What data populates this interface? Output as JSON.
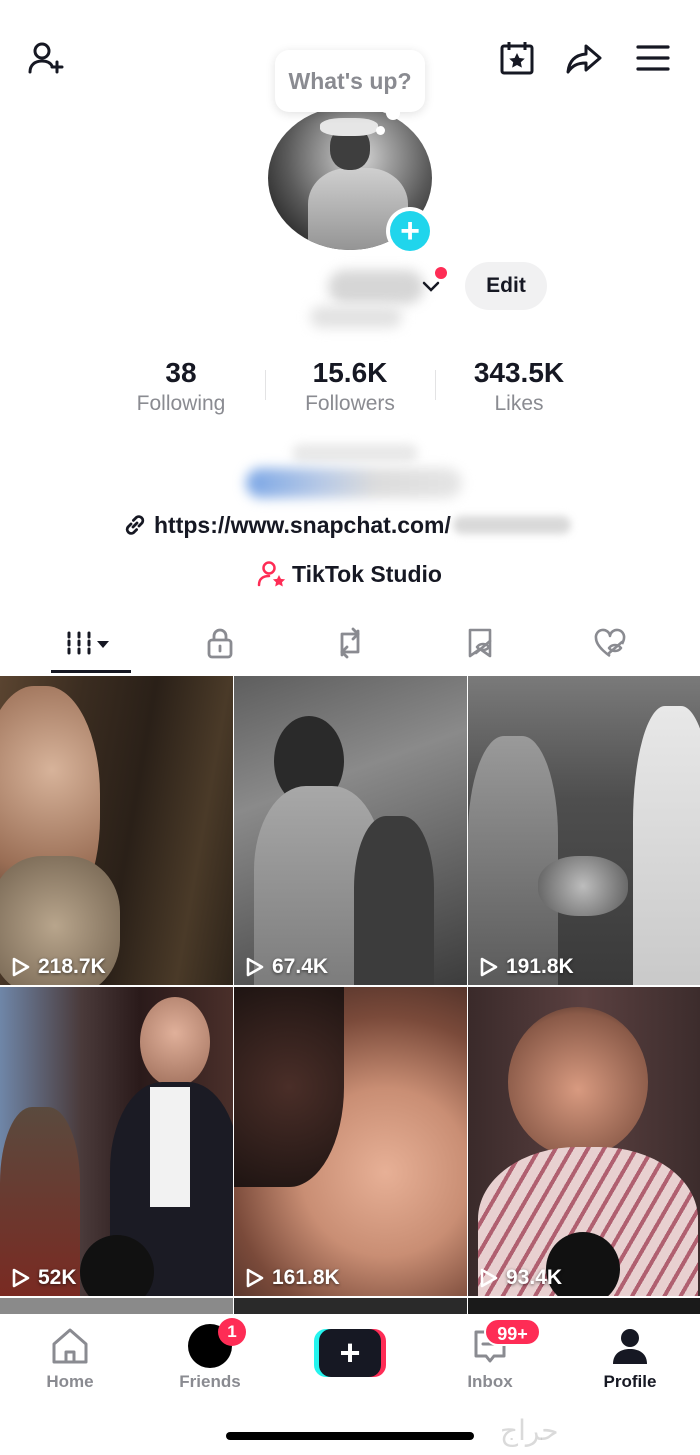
{
  "status_bubble": {
    "text": "What's up?"
  },
  "profile": {
    "edit_label": "Edit",
    "link_text": "https://www.snapchat.com/",
    "studio_label": "TikTok Studio"
  },
  "stats": [
    {
      "value": "38",
      "label": "Following"
    },
    {
      "value": "15.6K",
      "label": "Followers"
    },
    {
      "value": "343.5K",
      "label": "Likes"
    }
  ],
  "tabs": [
    {
      "icon": "videos-grid-icon",
      "active": true
    },
    {
      "icon": "lock-icon"
    },
    {
      "icon": "repost-icon"
    },
    {
      "icon": "favorites-icon"
    },
    {
      "icon": "liked-hidden-icon"
    }
  ],
  "videos": [
    {
      "views": "218.7K"
    },
    {
      "views": "67.4K"
    },
    {
      "views": "191.8K"
    },
    {
      "views": "52K"
    },
    {
      "views": "161.8K"
    },
    {
      "views": "93.4K"
    }
  ],
  "bottom_nav": {
    "home": "Home",
    "friends": "Friends",
    "friends_badge": "1",
    "create": "+",
    "inbox": "Inbox",
    "inbox_badge": "99+",
    "profile": "Profile"
  },
  "watermark": "حراج"
}
